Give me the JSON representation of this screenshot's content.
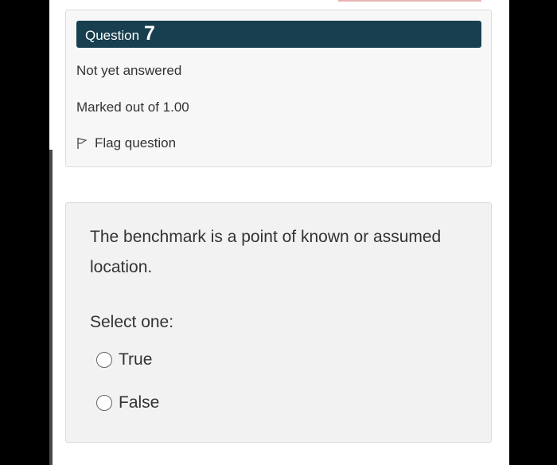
{
  "question": {
    "word": "Question",
    "number": "7",
    "state": "Not yet answered",
    "grade": "Marked out of 1.00",
    "flag_label": "Flag question"
  },
  "content": {
    "text": "The benchmark is a point of known or assumed location.",
    "prompt": "Select one:",
    "options": [
      {
        "label": "True",
        "selected": false
      },
      {
        "label": "False",
        "selected": false
      }
    ]
  },
  "colors": {
    "header_bg": "#173f4f",
    "panel_bg": "#f7f7f7",
    "content_bg": "#f2f2f2"
  },
  "icons": {
    "flag": "flag-icon",
    "radio": "radio-unchecked-icon"
  }
}
